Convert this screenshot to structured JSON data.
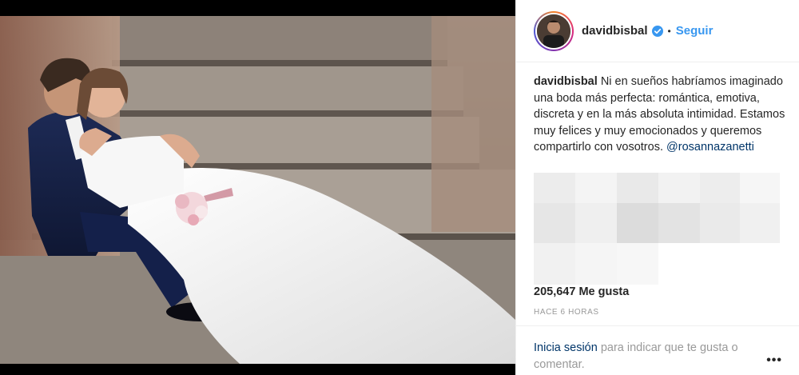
{
  "post": {
    "image_description_icon": "wedding-photo",
    "header": {
      "username": "davidbisbal",
      "verified_icon": "verified-badge-icon",
      "separator": "•",
      "follow_label": "Seguir"
    },
    "caption": {
      "username": "davidbisbal",
      "text": "Ni en sueños habríamos imaginado una boda más perfecta: romántica, emotiva, discreta y en la más absoluta intimidad. Estamos muy felices y muy emocionados y queremos compartirlo con vosotros.",
      "mention": "@rosannazanetti"
    },
    "likes": "205,647 Me gusta",
    "timestamp": "HACE 6 HORAS",
    "footer": {
      "login_link": "Inicia sesión",
      "login_rest": "para indicar que te gusta o comentar.",
      "more_label": "•••"
    },
    "colors": {
      "link_blue": "#3897f0",
      "mention_blue": "#003569",
      "text_dark": "#262626",
      "text_muted": "#999999",
      "border": "#efefef"
    }
  }
}
